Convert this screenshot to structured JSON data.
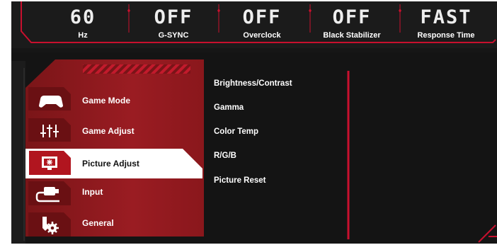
{
  "status_bar": [
    {
      "value": "60",
      "label": "Hz"
    },
    {
      "value": "OFF",
      "label": "G-SYNC"
    },
    {
      "value": "OFF",
      "label": "Overclock"
    },
    {
      "value": "OFF",
      "label": "Black Stabilizer"
    },
    {
      "value": "FAST",
      "label": "Response Time"
    }
  ],
  "menu": {
    "items": [
      {
        "label": "Game Mode",
        "icon": "gamepad-icon"
      },
      {
        "label": "Game Adjust",
        "icon": "sliders-icon"
      },
      {
        "label": "Picture Adjust",
        "icon": "picture-icon"
      },
      {
        "label": "Input",
        "icon": "input-plug-icon"
      },
      {
        "label": "General",
        "icon": "gear-wrench-icon"
      }
    ],
    "selected": "Picture Adjust"
  },
  "submenu": {
    "items": [
      "Brightness/Contrast",
      "Gamma",
      "Color Temp",
      "R/G/B",
      "Picture Reset"
    ]
  },
  "colors": {
    "background": "#141414",
    "accent_red": "#c8102e",
    "menu_red": "#8e1a1f",
    "selected_bg": "#ffffff"
  }
}
